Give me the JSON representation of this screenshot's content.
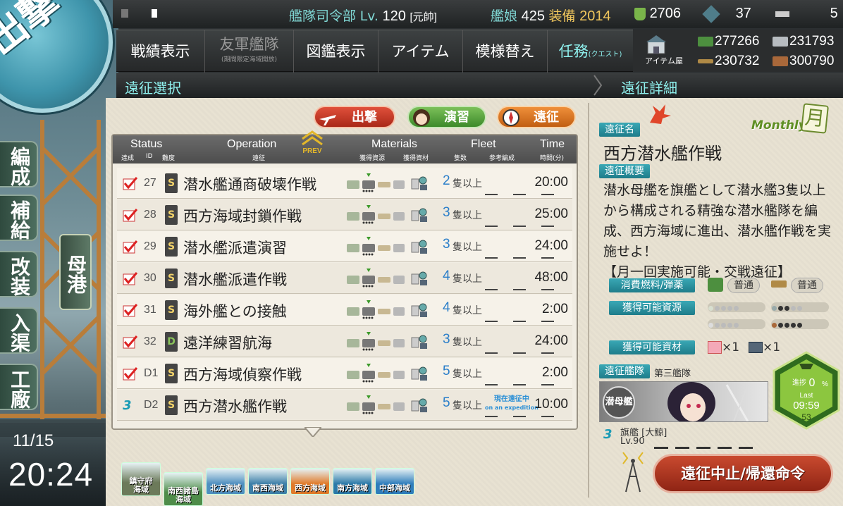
{
  "top_bar": {
    "hq_label": "艦隊司令部",
    "lv_label": "Lv.",
    "level": "120",
    "rank": "[元帥]",
    "ships_label": "艦娘",
    "ships": "425",
    "equip_label": "装備",
    "equip": "2014",
    "buckets": "2706",
    "dev_mats": "37",
    "screws": "5"
  },
  "menu": {
    "record": "戦績表示",
    "friend_fleet": "友軍艦隊",
    "friend_fleet_sub": "(期間限定海域開放)",
    "album": "図鑑表示",
    "items": "アイテム",
    "remodel": "模様替え",
    "quests": "任務",
    "quests_sub": "(クエスト)",
    "item_shop": "アイテム屋"
  },
  "resources": {
    "fuel": "277266",
    "steel": "231793",
    "ammo": "230732",
    "bauxite": "300790"
  },
  "sections": {
    "left": "遠征選択",
    "right": "遠征詳細"
  },
  "tabs": {
    "sortie": "出撃",
    "exercise": "演習",
    "expedition": "遠征"
  },
  "sidebar": {
    "sortie_emblem": "出撃",
    "organize": "編成",
    "supply": "補給",
    "remodel": "改装",
    "dock": "入渠",
    "arsenal": "工廠",
    "home": "母港"
  },
  "clock": {
    "date": "11/15",
    "time": "20:24"
  },
  "list": {
    "headers": {
      "status": "Status",
      "status_sub1": "達成",
      "status_sub2": "ID",
      "status_sub3": "難度",
      "operation": "Operation",
      "operation_sub": "遠征",
      "materials": "Materials",
      "materials_sub1": "獲得資源",
      "materials_sub2": "獲得資材",
      "fleet": "Fleet",
      "fleet_sub1": "隻数",
      "fleet_sub2": "参考編成",
      "time": "Time",
      "time_sub": "時間(分)",
      "prev": "PREV"
    },
    "rows": [
      {
        "id": "27",
        "rank": "S",
        "name": "潜水艦通商破壊作戦",
        "fleet": "2",
        "unit": "隻以上",
        "time": "20:00",
        "status": "done"
      },
      {
        "id": "28",
        "rank": "S",
        "name": "西方海域封鎖作戦",
        "fleet": "3",
        "unit": "隻以上",
        "time": "25:00",
        "status": "done"
      },
      {
        "id": "29",
        "rank": "S",
        "name": "潜水艦派遣演習",
        "fleet": "3",
        "unit": "隻以上",
        "time": "24:00",
        "status": "done"
      },
      {
        "id": "30",
        "rank": "S",
        "name": "潜水艦派遣作戦",
        "fleet": "4",
        "unit": "隻以上",
        "time": "48:00",
        "status": "done"
      },
      {
        "id": "31",
        "rank": "S",
        "name": "海外艦との接触",
        "fleet": "4",
        "unit": "隻以上",
        "time": "2:00",
        "status": "done"
      },
      {
        "id": "32",
        "rank": "D",
        "name": "遠洋練習航海",
        "fleet": "3",
        "unit": "隻以上",
        "time": "24:00",
        "status": "done"
      },
      {
        "id": "D1",
        "rank": "S",
        "name": "西方海域偵察作戦",
        "fleet": "5",
        "unit": "隻以上",
        "time": "2:00",
        "status": "done"
      },
      {
        "id": "D2",
        "rank": "S",
        "name": "西方潜水艦作戦",
        "fleet": "5",
        "unit": "隻以上",
        "time": "10:00",
        "status": "going",
        "going_jp": "現在遠征中",
        "going_en": "on an expedition"
      }
    ]
  },
  "areas": [
    {
      "line1": "鎮守府",
      "line2": "海域"
    },
    {
      "line1": "南西諸島",
      "line2": "海域"
    },
    {
      "line1": "北方海域",
      "line2": ""
    },
    {
      "line1": "南西海域",
      "line2": ""
    },
    {
      "line1": "西方海域",
      "line2": ""
    },
    {
      "line1": "南方海域",
      "line2": ""
    },
    {
      "line1": "中部海域",
      "line2": ""
    }
  ],
  "detail": {
    "name_tag": "遠征名",
    "monthly": "Monthly",
    "monthly_kanji": "月",
    "name": "西方潜水艦作戦",
    "overview_tag": "遠征概要",
    "overview": "潜水母艦を旗艦として潜水艦3隻以上から構成される精強な潜水艦隊を編成、西方海域に進出、潜水艦作戦を実施せよ！",
    "overview_note": "【月一回実施可能・交戦遠征】",
    "consume_tag": "消費燃料/弾薬",
    "consume_fuel": "普通",
    "consume_ammo": "普通",
    "resources_tag": "獲得可能資源",
    "materials_tag": "獲得可能資材",
    "material_a": "×1",
    "material_b": "×1",
    "fleet_tag": "遠征艦隊",
    "fleet_name": "第三艦隊",
    "flagship_banner": "潜母艦",
    "flagship": "旗艦 [大鯨]",
    "flagship_lv": "Lv.90",
    "progress_label": "進捗",
    "progress": "0",
    "progress_unit": "%",
    "last_label": "Last",
    "last_time": "09:59",
    "last_sec": "53",
    "recall": "遠征中止/帰還命令"
  },
  "colors": {
    "accent_cyan": "#8ff1ee",
    "panel_bg": "#e8e2d2",
    "bar_dark": "#2b2d2e",
    "tag_teal": "#2a93a1",
    "recall_red": "#b23a22"
  }
}
